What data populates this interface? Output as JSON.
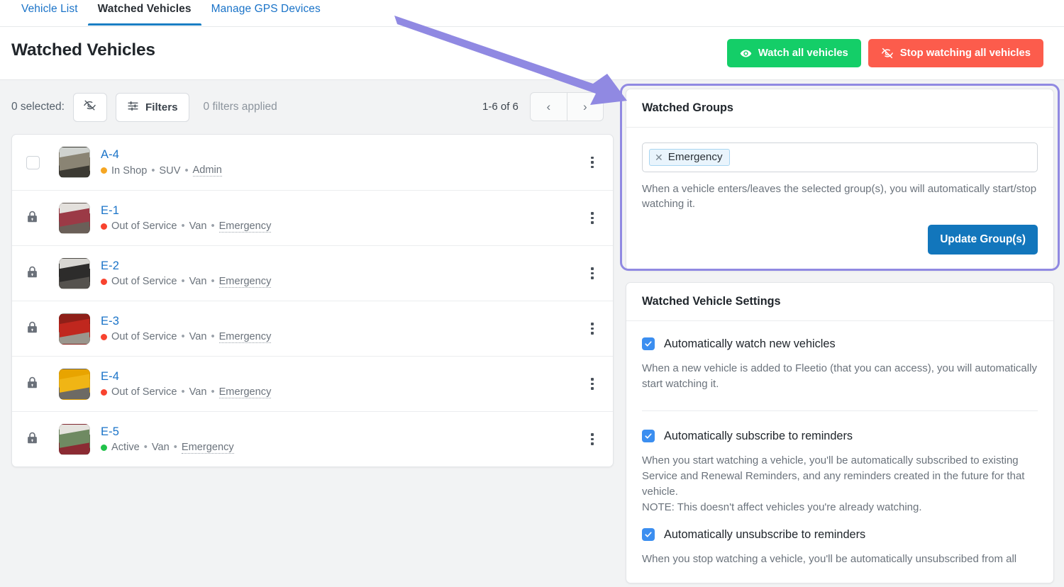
{
  "tabs": [
    {
      "label": "Vehicle List",
      "active": false
    },
    {
      "label": "Watched Vehicles",
      "active": true
    },
    {
      "label": "Manage GPS Devices",
      "active": false
    }
  ],
  "header": {
    "title": "Watched Vehicles",
    "watch_all_label": "Watch all vehicles",
    "stop_watching_all_label": "Stop watching all vehicles",
    "watch_all_color": "#14ce68",
    "stop_watching_color": "#fc5c4c"
  },
  "toolbar": {
    "selected_label": "0 selected:",
    "hide_icon": "eye-slash-icon",
    "filters_label": "Filters",
    "filters_icon": "sliders-icon",
    "filters_applied_label": "0 filters applied",
    "pagination_range": "1-6 of 6",
    "prev_label": "‹",
    "next_label": "›"
  },
  "vehicles": [
    {
      "name": "A-4",
      "locked": false,
      "status": "In Shop",
      "status_color": "#f5a623",
      "type": "SUV",
      "group": "Admin",
      "thumb_colors": [
        "#8a8474",
        "#cfd2cf",
        "#3c3a33"
      ]
    },
    {
      "name": "E-1",
      "locked": true,
      "status": "Out of Service",
      "status_color": "#f8432f",
      "type": "Van",
      "group": "Emergency",
      "thumb_colors": [
        "#9b3a46",
        "#e3e0dc",
        "#6a5f58"
      ]
    },
    {
      "name": "E-2",
      "locked": true,
      "status": "Out of Service",
      "status_color": "#f8432f",
      "type": "Van",
      "group": "Emergency",
      "thumb_colors": [
        "#2d2c2b",
        "#d8d6d2",
        "#55524e"
      ]
    },
    {
      "name": "E-3",
      "locked": true,
      "status": "Out of Service",
      "status_color": "#f8432f",
      "type": "Van",
      "group": "Emergency",
      "thumb_colors": [
        "#c0271e",
        "#8f1f18",
        "#9a968d"
      ]
    },
    {
      "name": "E-4",
      "locked": true,
      "status": "Out of Service",
      "status_color": "#f8432f",
      "type": "Van",
      "group": "Emergency",
      "thumb_colors": [
        "#f0b515",
        "#e8a400",
        "#6d6a64"
      ]
    },
    {
      "name": "E-5",
      "locked": true,
      "status": "Active",
      "status_color": "#21c24a",
      "type": "Van",
      "group": "Emergency",
      "thumb_colors": [
        "#6f8a62",
        "#e5e3de",
        "#8b2b33"
      ]
    }
  ],
  "watched_groups": {
    "title": "Watched Groups",
    "tokens": [
      {
        "label": "Emergency",
        "remove_icon": "close-icon"
      }
    ],
    "helper": "When a vehicle enters/leaves the selected group(s), you will automatically start/stop watching it.",
    "update_button_label": "Update Group(s)",
    "update_button_color": "#1276bc"
  },
  "settings": {
    "title": "Watched Vehicle Settings",
    "checkbox_color": "#3b8ef0",
    "items": [
      {
        "label": "Automatically watch new vehicles",
        "checked": true,
        "desc": "When a new vehicle is added to Fleetio (that you can access), you will automatically start watching it."
      },
      {
        "label": "Automatically subscribe to reminders",
        "checked": true,
        "desc": "When you start watching a vehicle, you'll be automatically subscribed to existing Service and Renewal Reminders, and any reminders created in the future for that vehicle.\nNOTE: This doesn't affect vehicles you're already watching."
      },
      {
        "label": "Automatically unsubscribe to reminders",
        "checked": true,
        "desc": "When you stop watching a vehicle, you'll be automatically unsubscribed from all"
      }
    ]
  },
  "annotation": {
    "arrow_color": "#9089e2",
    "highlight_color": "#9089e2"
  }
}
